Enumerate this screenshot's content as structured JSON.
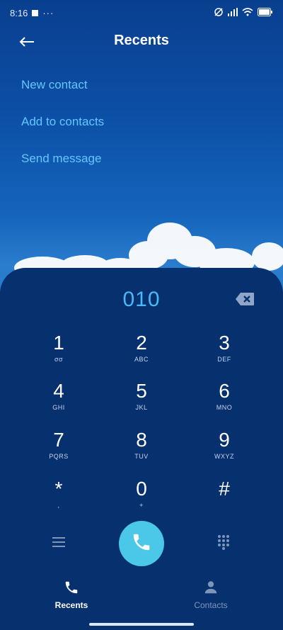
{
  "status_bar": {
    "time": "8:16",
    "more": "···",
    "battery": "",
    "icons": [
      "notification-square-icon",
      "alarm-off-icon",
      "signal-icon",
      "wifi-icon",
      "battery-icon"
    ]
  },
  "header": {
    "title": "Recents",
    "back_icon": "arrow-left-icon"
  },
  "actions": [
    "New contact",
    "Add to contacts",
    "Send message"
  ],
  "dial": {
    "number": "010",
    "keys": [
      {
        "digit": "1",
        "letters": "σσ"
      },
      {
        "digit": "2",
        "letters": "ABC"
      },
      {
        "digit": "3",
        "letters": "DEF"
      },
      {
        "digit": "4",
        "letters": "GHI"
      },
      {
        "digit": "5",
        "letters": "JKL"
      },
      {
        "digit": "6",
        "letters": "MNO"
      },
      {
        "digit": "7",
        "letters": "PQRS"
      },
      {
        "digit": "8",
        "letters": "TUV"
      },
      {
        "digit": "9",
        "letters": "WXYZ"
      },
      {
        "digit": "*",
        "letters": ","
      },
      {
        "digit": "0",
        "letters": "+"
      },
      {
        "digit": "#",
        "letters": ""
      }
    ]
  },
  "nav": {
    "recents": "Recents",
    "contacts": "Contacts"
  },
  "colors": {
    "accent": "#4bb8f5",
    "call_button": "#4bc7e8",
    "panel": "#06306e",
    "link": "#64c7ff"
  }
}
